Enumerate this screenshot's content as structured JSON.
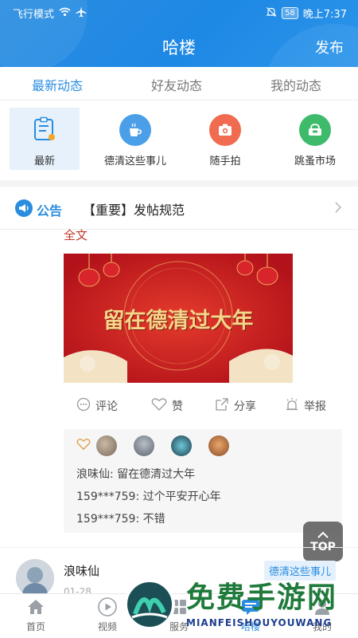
{
  "status_bar": {
    "mode": "飞行模式",
    "battery": "58",
    "time": "晚上7:37"
  },
  "header": {
    "title": "哈楼",
    "publish_label": "发布"
  },
  "tabs": [
    {
      "label": "最新动态",
      "active": true
    },
    {
      "label": "好友动态",
      "active": false
    },
    {
      "label": "我的动态",
      "active": false
    }
  ],
  "quick_menu": [
    {
      "label": "最新",
      "icon": "note-icon",
      "selected": true
    },
    {
      "label": "德清这些事儿",
      "icon": "coffee-cup-icon",
      "color": "#4a9fe8"
    },
    {
      "label": "随手拍",
      "icon": "camera-icon",
      "color": "#f06b4f"
    },
    {
      "label": "跳蚤市场",
      "icon": "basket-icon",
      "color": "#3dbb6a"
    }
  ],
  "notice": {
    "tag": "公告",
    "text": "【重要】发帖规范"
  },
  "post": {
    "full_text_link": "全文",
    "image_caption": "留在德清过大年",
    "actions": {
      "comment": "评论",
      "like": "赞",
      "share": "分享",
      "report": "举报"
    },
    "comments": [
      {
        "user": "浪味仙",
        "text": "留在德清过大年"
      },
      {
        "user": "159***759",
        "text": "过个平安开心年"
      },
      {
        "user": "159***759",
        "text": "不错"
      }
    ]
  },
  "top_button": "TOP",
  "post2": {
    "author": "浪味仙",
    "topic": "德清这些事儿",
    "time": "01-28"
  },
  "bottom_nav": [
    {
      "label": "首页",
      "icon": "home-icon"
    },
    {
      "label": "视频",
      "icon": "play-icon"
    },
    {
      "label": "服务",
      "icon": "grid-icon"
    },
    {
      "label": "哈楼",
      "icon": "chat-icon"
    },
    {
      "label": "我的",
      "icon": "user-icon"
    }
  ],
  "watermark": {
    "text": "免费手游网",
    "site": "MIANFEISHOUYOUWANG"
  },
  "colors": {
    "accent": "#2a8de0",
    "header": "#1e88e5",
    "link_red": "#c0392b"
  }
}
